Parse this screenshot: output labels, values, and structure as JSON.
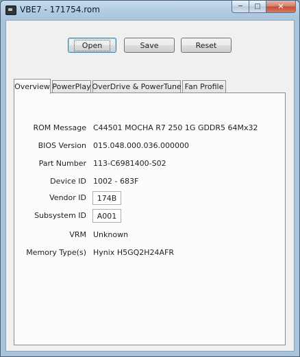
{
  "window": {
    "title": "VBE7 - 171754.rom"
  },
  "controls": {
    "minimize": "─",
    "maximize": "□",
    "close": "✕"
  },
  "toolbar": {
    "open_label": "Open",
    "save_label": "Save",
    "reset_label": "Reset"
  },
  "tabs": [
    "Overview",
    "PowerPlay",
    "OverDrive & PowerTune",
    "Fan Profile"
  ],
  "overview": {
    "rom_message": {
      "label": "ROM Message",
      "value": "C44501 MOCHA R7 250 1G GDDR5 64Mx32"
    },
    "bios_version": {
      "label": "BIOS Version",
      "value": "015.048.000.036.000000"
    },
    "part_number": {
      "label": "Part Number",
      "value": "113-C6981400-S02"
    },
    "device_id": {
      "label": "Device ID",
      "value": "1002 - 683F"
    },
    "vendor_id": {
      "label": "Vendor ID",
      "value": "174B"
    },
    "subsystem_id": {
      "label": "Subsystem ID",
      "value": "A001"
    },
    "vrm": {
      "label": "VRM",
      "value": "Unknown"
    },
    "memory_type": {
      "label": "Memory Type(s)",
      "value": "Hynix H5GQ2H24AFR"
    }
  }
}
